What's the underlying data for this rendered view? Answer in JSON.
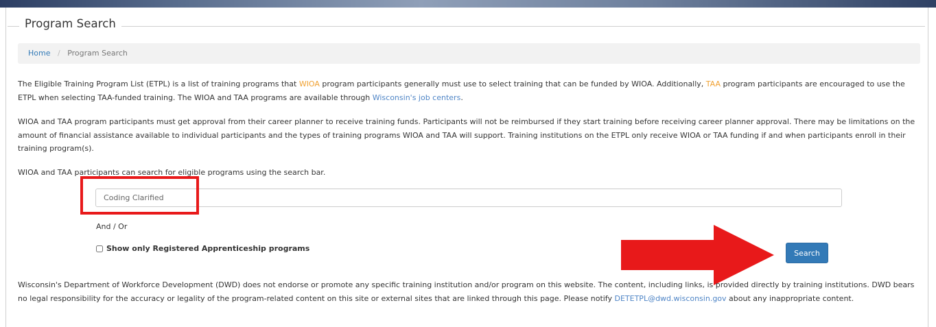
{
  "page": {
    "legend": "Program Search"
  },
  "breadcrumb": {
    "home": "Home",
    "separator": "/",
    "current": "Program Search"
  },
  "intro": {
    "p1_a": "The Eligible Training Program List (ETPL) is a list of training programs that ",
    "p1_wioa": "WIOA",
    "p1_b": " program participants generally must use to select training that can be funded by WIOA. Additionally, ",
    "p1_taa": "TAA",
    "p1_c": " program participants are encouraged to use the ETPL when selecting TAA-funded training. The WIOA and TAA programs are available through ",
    "p1_link": "Wisconsin's job centers",
    "p1_d": ".",
    "p2": "WIOA and TAA program participants must get approval from their career planner to receive training funds. Participants will not be reimbursed if they start training before receiving career planner approval. There may be limitations on the amount of financial assistance available to individual participants and the types of training programs WIOA and TAA will support. Training institutions on the ETPL only receive WIOA or TAA funding if and when participants enroll in their training program(s).",
    "p3": "WIOA and TAA participants can search for eligible programs using the search bar."
  },
  "search": {
    "value": "Coding Clarified",
    "and_or": "And / Or",
    "checkbox_label": "Show only Registered Apprenticeship programs",
    "checkbox_checked": false,
    "button_label": "Search"
  },
  "disclaimer": {
    "text_a": "Wisconsin's Department of Workforce Development (DWD) does not endorse or promote any specific training institution and/or program on this website. The content, including links, is provided directly by training institutions. DWD bears no legal responsibility for the accuracy or legality of the program-related content on this site or external sites that are linked through this page. Please notify ",
    "email": "DETETPL@dwd.wisconsin.gov",
    "text_b": " about any inappropriate content."
  },
  "colors": {
    "link": "#4f85c6",
    "accent_orange": "#f0a030",
    "button": "#337ab7",
    "annotation_red": "#e8191a"
  }
}
